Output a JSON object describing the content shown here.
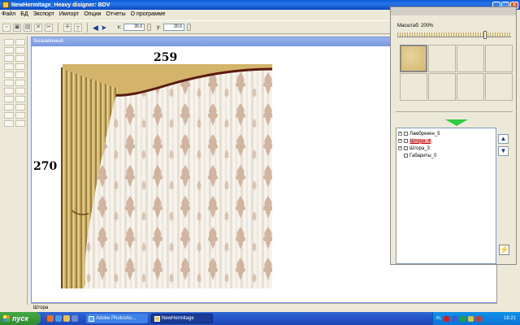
{
  "window": {
    "title": "NewHermitage_Heavy    disigner: BDV"
  },
  "menu": {
    "items": [
      "Файл",
      "БД",
      "Экспорт",
      "Импорт",
      "Опции",
      "Отчеты",
      "О программе"
    ]
  },
  "toolbar": {
    "x_label": "x:",
    "x_value": "35.0",
    "y_label": "y:",
    "y_value": "20.0"
  },
  "document": {
    "title": "Безымянный",
    "width_dim": "259",
    "height_dim": "270"
  },
  "status": {
    "text": "Штора"
  },
  "panel": {
    "zoom_label": "Масштаб: 200%",
    "zoom_level_fraction": 0.78,
    "layers": [
      {
        "label": "Ламбрекен_5",
        "checkbox": true,
        "expandable": true,
        "selected": false
      },
      {
        "label": "Штора_4",
        "checkbox": true,
        "expandable": true,
        "selected": true
      },
      {
        "label": "Штора_3",
        "checkbox": true,
        "expandable": true,
        "selected": false
      },
      {
        "label": "Габариты_0",
        "checkbox": true,
        "expandable": false,
        "selected": false
      }
    ]
  },
  "taskbar": {
    "start_label": "пуск",
    "tasks": [
      "Adobe Photosho...",
      "NewHermitage"
    ],
    "lang": "RL",
    "clock": "18:21"
  },
  "colors": {
    "titlebar": "#0a5bd8",
    "curtain_gold": "#d4b46a",
    "curtain_dark": "#8b6a2c",
    "valance_edge": "#5a1a10",
    "pattern": "#c9a88e",
    "selection": "#f3a8a8"
  }
}
